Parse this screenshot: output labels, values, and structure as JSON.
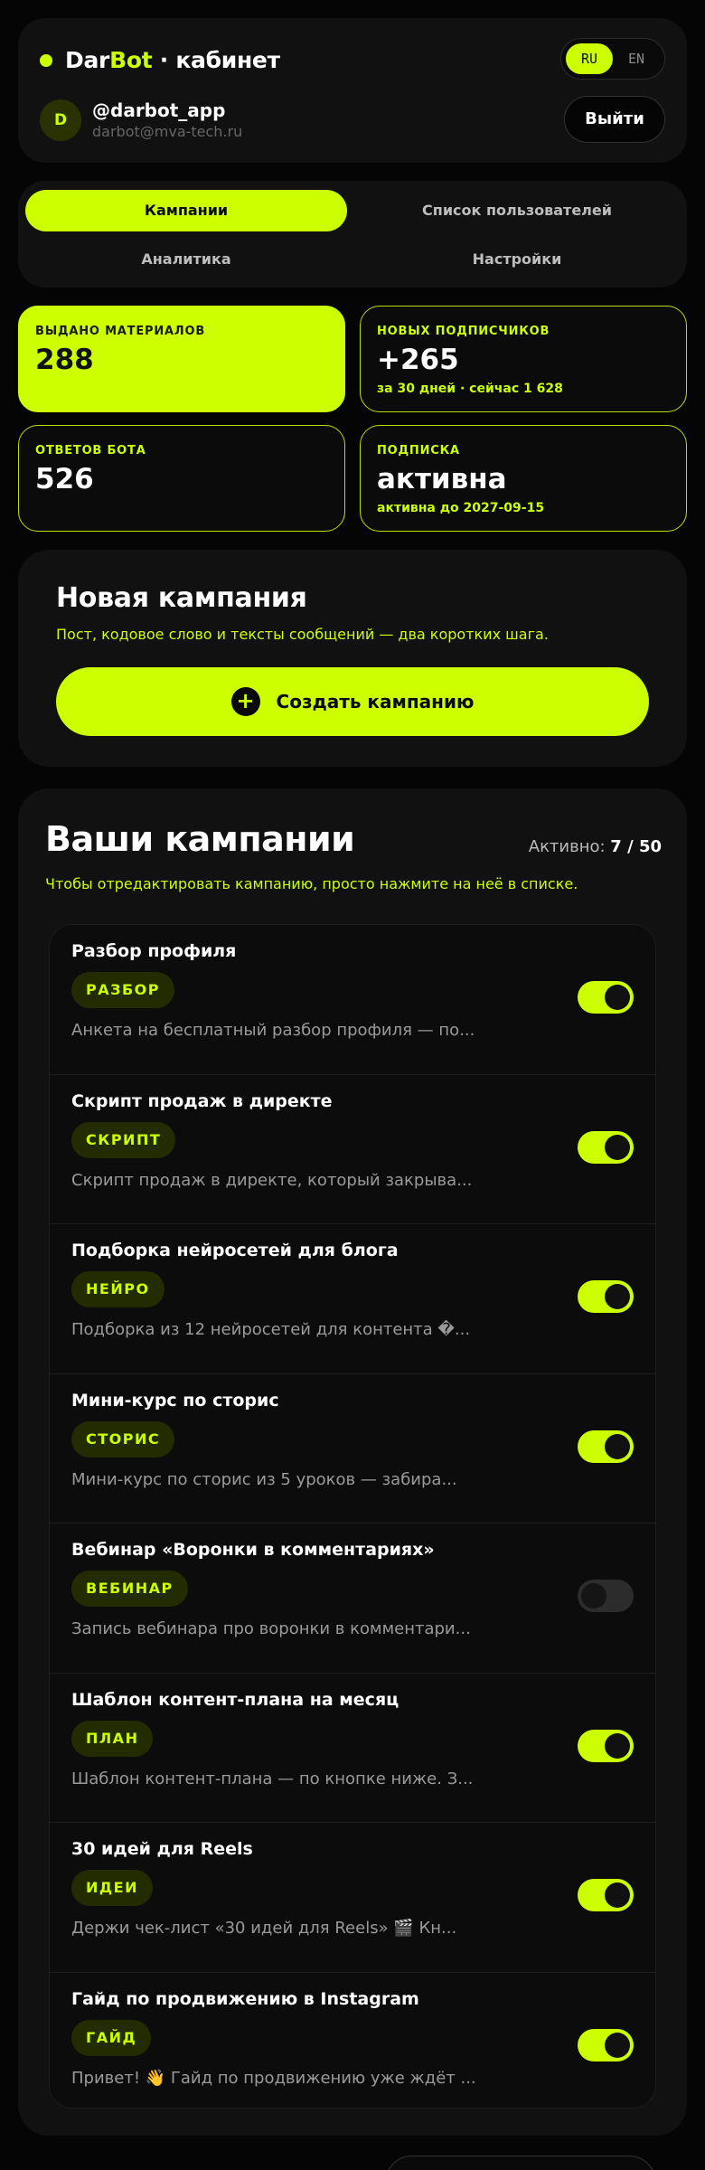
{
  "header": {
    "brand_part1": "Dar",
    "brand_part2": "Bot",
    "brand_part3": " · кабинет",
    "lang_ru": "RU",
    "lang_en": "EN",
    "avatar_letter": "D",
    "username": "@darbot_app",
    "email": "darbot@mva-tech.ru",
    "logout_label": "Выйти"
  },
  "nav": {
    "tabs": [
      {
        "label": "Кампании"
      },
      {
        "label": "Список пользователей"
      },
      {
        "label": "Аналитика"
      },
      {
        "label": "Настройки"
      }
    ]
  },
  "stats": [
    {
      "label": "ВЫДАНО МАТЕРИАЛОВ",
      "value": "288",
      "sub": ""
    },
    {
      "label": "НОВЫХ ПОДПИСЧИКОВ",
      "value": "+265",
      "sub": "за 30 дней · сейчас 1 628"
    },
    {
      "label": "ОТВЕТОВ БОТА",
      "value": "526",
      "sub": ""
    },
    {
      "label": "ПОДПИСКА",
      "value": "активна",
      "sub": "активна до 2027-09-15"
    }
  ],
  "new_campaign": {
    "title": "Новая кампания",
    "subtitle": "Пост, кодовое слово и тексты сообщений — два коротких шага.",
    "button_label": "Создать кампанию",
    "button_icon": "+"
  },
  "campaigns": {
    "title": "Ваши кампании",
    "active_prefix": "Активно: ",
    "active_count": "7",
    "active_sep": " / ",
    "active_total": "50",
    "hint": "Чтобы отредактировать кампанию, просто нажмите на неё в списке.",
    "items": [
      {
        "name": "Разбор профиля",
        "tag": "РАЗБОР",
        "desc": "Анкета на бесплатный разбор профиля — по...",
        "enabled": true
      },
      {
        "name": "Скрипт продаж в директе",
        "tag": "СКРИПТ",
        "desc": "Скрипт продаж в директе, который закрыва...",
        "enabled": true
      },
      {
        "name": "Подборка нейросетей для блога",
        "tag": "НЕЙРО",
        "desc": "Подборка из 12 нейросетей для контента �...",
        "enabled": true
      },
      {
        "name": "Мини-курс по сторис",
        "tag": "СТОРИС",
        "desc": "Мини-курс по сторис из 5 уроков — забира...",
        "enabled": true
      },
      {
        "name": "Вебинар «Воронки в комментариях»",
        "tag": "ВЕБИНАР",
        "desc": "Запись вебинара про воронки в комментари...",
        "enabled": false
      },
      {
        "name": "Шаблон контент-плана на месяц",
        "tag": "ПЛАН",
        "desc": "Шаблон контент-плана — по кнопке ниже. З...",
        "enabled": true
      },
      {
        "name": "30 идей для Reels",
        "tag": "ИДЕИ",
        "desc": "Держи чек-лист «30 идей для Reels» 🎬 Кн...",
        "enabled": true
      },
      {
        "name": "Гайд по продвижению в Instagram",
        "tag": "ГАЙД",
        "desc": "Привет! 👋 Гайд по продвижению уже ждёт ...",
        "enabled": true
      }
    ]
  },
  "colors": {
    "accent": "#ccff00",
    "background": "#050505",
    "card": "#111111"
  }
}
